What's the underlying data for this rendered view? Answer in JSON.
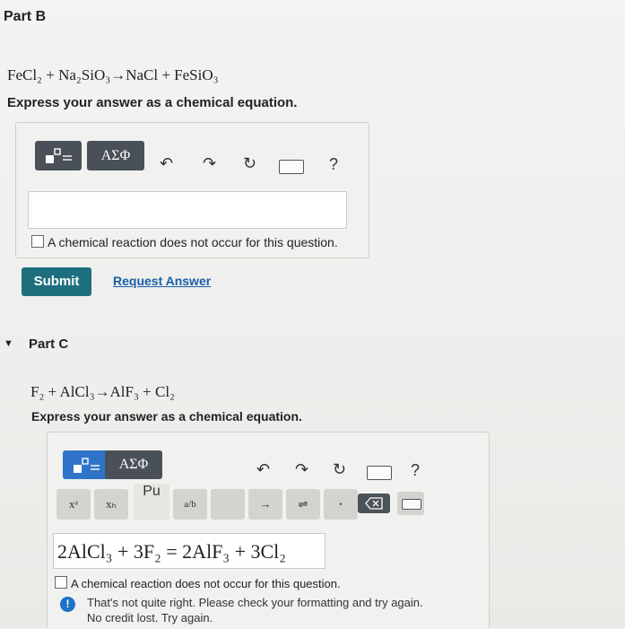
{
  "partB": {
    "title": "Part B",
    "equation": "FeCl₂ + Na₂SiO₃→NaCl + FeSiO₃",
    "instruction": "Express your answer as a chemical equation.",
    "toolbar": {
      "template_icon": "template-icon",
      "greek_label": "ΑΣΦ",
      "undo_icon": "undo-icon",
      "redo_icon": "redo-icon",
      "reset_icon": "reset-icon",
      "keyboard_icon": "keyboard-icon",
      "help_label": "?"
    },
    "answer_value": "",
    "no_reaction_label": "A chemical reaction does not occur for this question.",
    "submit_label": "Submit",
    "request_label": "Request Answer"
  },
  "partC": {
    "title": "Part C",
    "equation": "F₂ + AlCl₃→AlF₃ + Cl₂",
    "instruction": "Express your answer as a chemical equation.",
    "toolbar": {
      "greek_label": "ΑΣΦ",
      "help_label": "?",
      "periodic_label": "Pu"
    },
    "palette": {
      "superscript": "xᵃ",
      "subscript": "xₕ",
      "fraction": "a/b",
      "arrow": "→",
      "equilibrium": "⇌",
      "dot": "•"
    },
    "answer_value": "2AlCl₃ + 3F₂ = 2AlF₃ + 3Cl₂",
    "no_reaction_label": "A chemical reaction does not occur for this question.",
    "feedback_line1": "That's not quite right. Please check your formatting and try again.",
    "feedback_line2": "No credit lost. Try again."
  },
  "colors": {
    "submit": "#1e6f7d",
    "link": "#1a5fa8",
    "active_tool": "#2f74c9",
    "warning": "#1e73c7"
  }
}
